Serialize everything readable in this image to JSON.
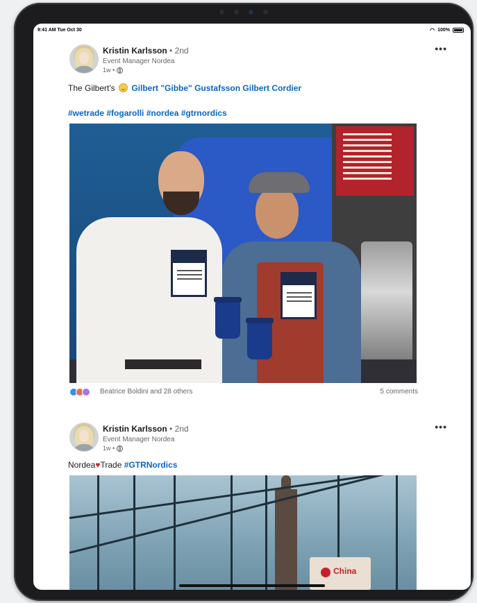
{
  "status_bar": {
    "time": "9:41 AM",
    "date": "Tue Oct 30",
    "battery": "100%"
  },
  "posts": [
    {
      "author": "Kristin Karlsson",
      "degree": "• 2nd",
      "role": "Event Manager Nordea",
      "age": "1w •",
      "text_prefix": "The Gilbert's",
      "mentions": "Gilbert \"Gibbe\" Gustafsson Gilbert Cordier",
      "hashtags": "#wetrade #fogarolli #nordea #gtrnordics",
      "reactions_text": "Beatrice Boldini and 28 others",
      "comments_text": "5 comments"
    },
    {
      "author": "Kristin Karlsson",
      "degree": "• 2nd",
      "role": "Event Manager Nordea",
      "age": "1w •",
      "text_a": "Nordea",
      "text_b": "Trade",
      "hashtag": "#GTRNordics",
      "photo_sign": "China"
    }
  ],
  "icons": {
    "more": "•••",
    "heart": "♥",
    "wifi": "wifi-icon"
  },
  "colors": {
    "link": "#0a66c2",
    "like": "#378fe9",
    "love": "#df704d",
    "heart": "#d1222b"
  }
}
